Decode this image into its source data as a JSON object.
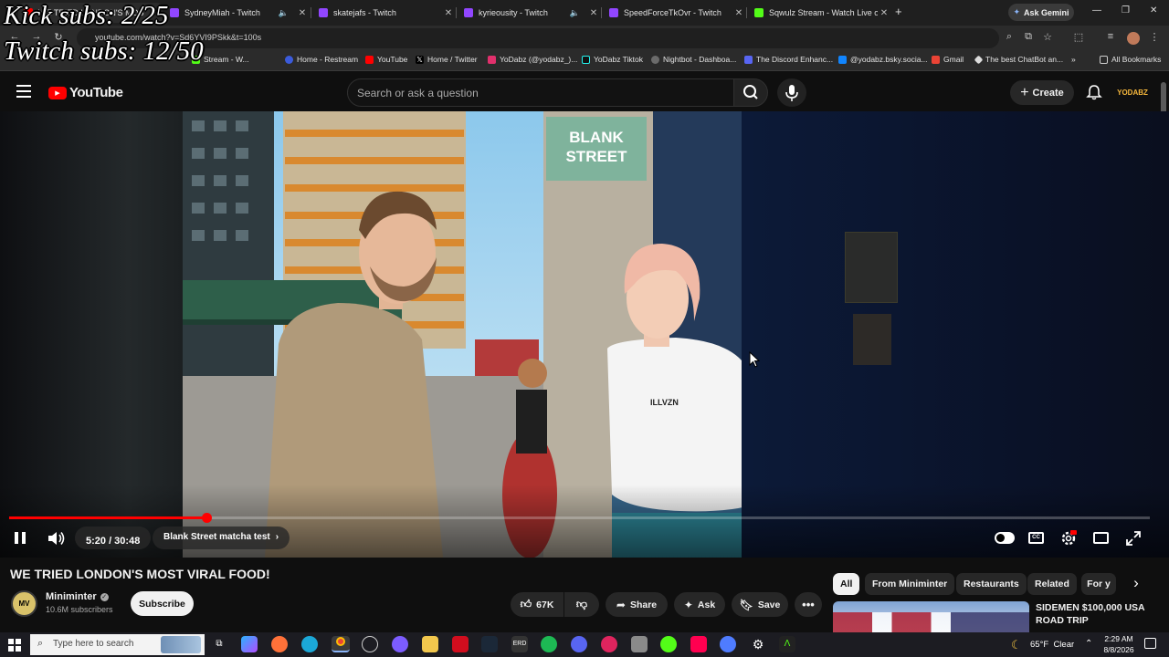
{
  "browser": {
    "tabs": [
      {
        "title": "WE TRIED LONDON'S MOS",
        "favicon_color": "#ff0000",
        "audio": false,
        "active": true
      },
      {
        "title": "SydneyMiah - Twitch",
        "favicon_color": "#9146ff",
        "audio": true,
        "active": false
      },
      {
        "title": "skatejafs - Twitch",
        "favicon_color": "#9146ff",
        "audio": false,
        "active": false
      },
      {
        "title": "kyrieousity - Twitch",
        "favicon_color": "#9146ff",
        "audio": true,
        "active": false
      },
      {
        "title": "SpeedForceTkOvr - Twitch",
        "favicon_color": "#9146ff",
        "audio": false,
        "active": false
      },
      {
        "title": "Sqwulz Stream - Watch Live on",
        "favicon_color": "#53fc18",
        "audio": false,
        "active": false
      }
    ],
    "new_tab": "+",
    "ask_gemini": "Ask Gemini",
    "window_controls": [
      "—",
      "❐",
      "✕"
    ],
    "url": "youtube.com/watch?v=Sd6YVI9PSkk&t=100s",
    "bookmarks": [
      {
        "label": "Stream - W...",
        "color": "#53fc18"
      },
      {
        "label": "Home - Restream",
        "color": "#3b5bdb"
      },
      {
        "label": "YouTube",
        "color": "#ff0000"
      },
      {
        "label": "Home / Twitter",
        "color": "#111111"
      },
      {
        "label": "YoDabz (@yodabz_)...",
        "color": "#e1306c"
      },
      {
        "label": "YoDabz Tiktok",
        "color": "#111111"
      },
      {
        "label": "Nightbot - Dashboa...",
        "color": "#6b6b6b"
      },
      {
        "label": "The Discord Enhanc...",
        "color": "#222222"
      },
      {
        "label": "@yodabz.bsky.socia...",
        "color": "#1185fe"
      },
      {
        "label": "Gmail",
        "color": "#ea4335"
      },
      {
        "label": "The best ChatBot an...",
        "color": "#dddddd"
      }
    ],
    "bookmarks_more": "»",
    "all_bookmarks": "All Bookmarks"
  },
  "overlay": {
    "kick_subs": "Kick subs: 2/25",
    "twitch_subs": "Twitch subs: 12/50"
  },
  "youtube": {
    "logo_text": "YouTube",
    "search_placeholder": "Search or ask a question",
    "create_label": "Create",
    "avatar_text": "YODABZ",
    "player": {
      "store_sign_line1": "BLANK",
      "store_sign_line2": "STREET",
      "shirt_text": "ILLVZN",
      "time": "5:20 / 30:48",
      "chapter": "Blank Street matcha test",
      "progress": 0.1732
    },
    "video": {
      "title": "WE TRIED LONDON'S MOST VIRAL FOOD!",
      "channel": "Miniminter",
      "channel_avatar_text": "MV",
      "subscribers": "10.6M subscribers",
      "subscribe_label": "Subscribe",
      "likes": "67K",
      "share_label": "Share",
      "ask_label": "Ask",
      "save_label": "Save"
    },
    "chips": [
      "All",
      "From Miniminter",
      "Restaurants",
      "Related",
      "For y"
    ],
    "recommended": {
      "title": "SIDEMEN $100,000 USA ROAD TRIP"
    }
  },
  "taskbar": {
    "search_placeholder": "Type here to search",
    "weather": "65°F  Clear",
    "time": "2:29 AM",
    "date": "8/8/2026"
  }
}
